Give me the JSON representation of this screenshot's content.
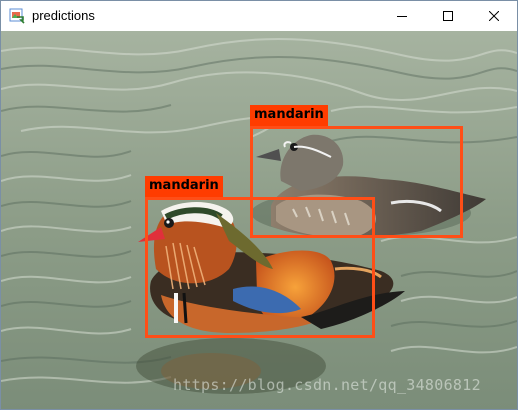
{
  "window": {
    "title": "predictions",
    "icon": "image-viewer-icon"
  },
  "controls": {
    "minimize_icon": "minimize-icon",
    "maximize_icon": "maximize-icon",
    "close_icon": "close-icon"
  },
  "detections": [
    {
      "label": "mandarin"
    },
    {
      "label": "mandarin"
    }
  ],
  "watermark": "https://blog.csdn.net/qq_34806812",
  "colors": {
    "box": "#ff4e17",
    "label_bg": "#ff3c00"
  }
}
